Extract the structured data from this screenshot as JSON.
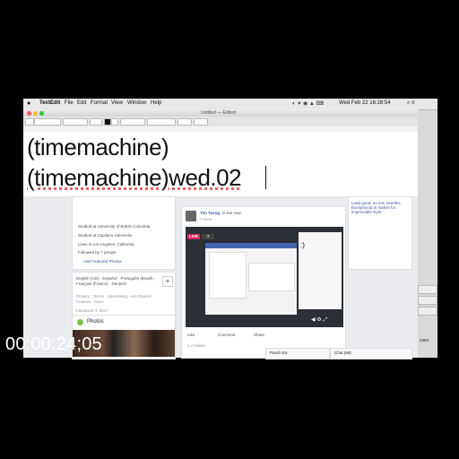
{
  "menubar": {
    "app": "TextEdit",
    "items": [
      "File",
      "Edit",
      "Format",
      "View",
      "Window",
      "Help"
    ],
    "clock": "Wed Feb 22  16:28:54"
  },
  "window": {
    "title": "Untitled — Edited"
  },
  "document": {
    "line1": "(timemachine)",
    "line2": "(timemachine)wed.02"
  },
  "facebook": {
    "about_items": [
      "Studied at University of British Columbia",
      "Studied at Capilano University",
      "Lives in Los Angeles, California",
      "Followed by 7 people"
    ],
    "add_photos": "Add Featured Photos",
    "languages": "English (US) · Español · Português (Brasil) · Français (France) · Deutsch",
    "footer_links": "Privacy · Terms · Advertising · Ad Choices · Cookies · More",
    "copyright": "Facebook © 2017",
    "photos_label": "Photos",
    "post_author": "Tim Tseng",
    "post_action": "is live now.",
    "post_meta": "7 mins",
    "live_badge": "LIVE",
    "live_viewers": "2",
    "like": "Like",
    "comment": "Comment",
    "share": "Share",
    "commenter": "J.J Gallon",
    "chat_person": "Panch Ea",
    "chat_label": "Chat (68)",
    "side_text": "Lead good, no iron needles, Exceptional tri makes for impeccable style."
  },
  "sidebar_right": {
    "count": "2353"
  },
  "panel_left": {
    "label1": "Scenes",
    "label2": "Scene"
  },
  "overlay": {
    "timecode": "00:00:24;05",
    "smiley": ":)"
  },
  "colors": {
    "menubar_bg": "#e8e8e8",
    "facebook_bg": "#e9ebee",
    "facebook_blue": "#365899",
    "live_red": "#e0245e"
  }
}
